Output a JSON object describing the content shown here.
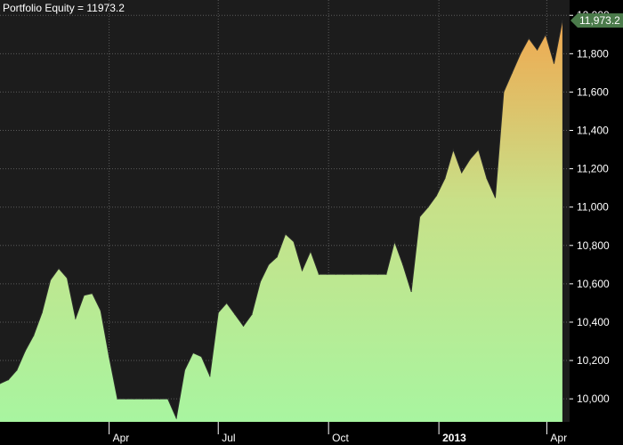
{
  "chart_data": {
    "type": "area",
    "title": "Portfolio Equity = 11973.2",
    "last_value_label": "11,973.2",
    "ylim": [
      9880,
      12080
    ],
    "yticks": [
      {
        "value": 10000,
        "label": "10,000"
      },
      {
        "value": 10200,
        "label": "10,200"
      },
      {
        "value": 10400,
        "label": "10,400"
      },
      {
        "value": 10600,
        "label": "10,600"
      },
      {
        "value": 10800,
        "label": "10,800"
      },
      {
        "value": 11000,
        "label": "11,000"
      },
      {
        "value": 11200,
        "label": "11,200"
      },
      {
        "value": 11400,
        "label": "11,400"
      },
      {
        "value": 11600,
        "label": "11,600"
      },
      {
        "value": 11800,
        "label": "11,800"
      },
      {
        "value": 12000,
        "label": "12,000"
      }
    ],
    "xlim": [
      "2012-01-01",
      "2013-04-20"
    ],
    "xticks": [
      {
        "date": "2012-04-01",
        "label": "Apr",
        "bold": false
      },
      {
        "date": "2012-07-01",
        "label": "Jul",
        "bold": false
      },
      {
        "date": "2012-10-01",
        "label": "Oct",
        "bold": false
      },
      {
        "date": "2013-01-01",
        "label": "2013",
        "bold": true
      },
      {
        "date": "2013-04-01",
        "label": "Apr",
        "bold": false
      }
    ],
    "grid": true,
    "series": [
      {
        "x": [
          "2012-01-01",
          "2012-01-08",
          "2012-01-15",
          "2012-01-22",
          "2012-01-29",
          "2012-02-05",
          "2012-02-12",
          "2012-02-19",
          "2012-02-26",
          "2012-03-04",
          "2012-03-11",
          "2012-03-18",
          "2012-03-25",
          "2012-04-01",
          "2012-04-08",
          "2012-04-15",
          "2012-04-22",
          "2012-04-29",
          "2012-05-06",
          "2012-05-13",
          "2012-05-20",
          "2012-05-27",
          "2012-06-03",
          "2012-06-10",
          "2012-06-17",
          "2012-06-24",
          "2012-07-01",
          "2012-07-08",
          "2012-07-15",
          "2012-07-22",
          "2012-07-29",
          "2012-08-05",
          "2012-08-12",
          "2012-08-19",
          "2012-08-26",
          "2012-09-02",
          "2012-09-09",
          "2012-09-16",
          "2012-09-23",
          "2012-09-30",
          "2012-10-07",
          "2012-10-14",
          "2012-10-21",
          "2012-10-28",
          "2012-11-04",
          "2012-11-11",
          "2012-11-18",
          "2012-11-25",
          "2012-12-02",
          "2012-12-09",
          "2012-12-16",
          "2012-12-23",
          "2012-12-30",
          "2013-01-06",
          "2013-01-13",
          "2013-01-20",
          "2013-01-27",
          "2013-02-03",
          "2013-02-10",
          "2013-02-17",
          "2013-02-24",
          "2013-03-03",
          "2013-03-10",
          "2013-03-17",
          "2013-03-24",
          "2013-03-31",
          "2013-04-07",
          "2013-04-14"
        ],
        "values": [
          10080,
          10100,
          10150,
          10250,
          10330,
          10450,
          10620,
          10680,
          10630,
          10420,
          10540,
          10550,
          10460,
          10220,
          10000,
          10000,
          10000,
          10000,
          10000,
          10000,
          10000,
          9900,
          10150,
          10240,
          10220,
          10120,
          10450,
          10500,
          10440,
          10380,
          10440,
          10610,
          10700,
          10740,
          10860,
          10820,
          10670,
          10770,
          10650,
          10650,
          10650,
          10650,
          10650,
          10650,
          10650,
          10650,
          10650,
          10820,
          10700,
          10560,
          10950,
          11000,
          11060,
          11150,
          11300,
          11180,
          11250,
          11300,
          11150,
          11050,
          11600,
          11700,
          11800,
          11880,
          11820,
          11900,
          11750,
          11973.2
        ]
      }
    ]
  },
  "colors": {
    "background": "#000000",
    "plot_background": "#1c1c1c",
    "grid": "#5a5a5a",
    "area_top": "#f0a850",
    "area_bottom": "#a8f5a0",
    "line": "#2a2a2a",
    "label_box": "#4a7a4a"
  }
}
